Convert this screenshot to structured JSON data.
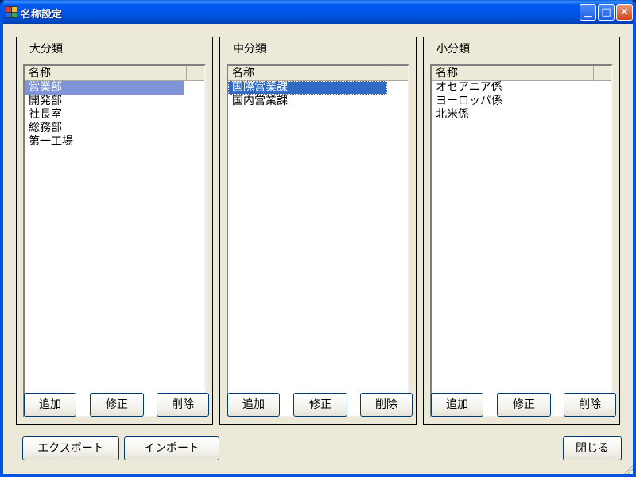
{
  "window": {
    "title": "名称設定",
    "colors": {
      "titlebar": "#0054e3",
      "face": "#ece9d8",
      "selection": "#316ac5"
    }
  },
  "groups": [
    {
      "label": "大分類",
      "column_header": "名称",
      "items": [
        "営業部",
        "開発部",
        "社長室",
        "総務部",
        "第一工場"
      ],
      "selected_index": 0,
      "buttons": {
        "add": "追加",
        "edit": "修正",
        "delete": "削除"
      }
    },
    {
      "label": "中分類",
      "column_header": "名称",
      "items": [
        "国際営業課",
        "国内営業課"
      ],
      "selected_index": 0,
      "buttons": {
        "add": "追加",
        "edit": "修正",
        "delete": "削除"
      }
    },
    {
      "label": "小分類",
      "column_header": "名称",
      "items": [
        "オセアニア係",
        "ヨーロッパ係",
        "北米係"
      ],
      "selected_index": null,
      "buttons": {
        "add": "追加",
        "edit": "修正",
        "delete": "削除"
      }
    }
  ],
  "footer": {
    "export_label": "エクスポート",
    "import_label": "インポート",
    "close_label": "閉じる"
  }
}
